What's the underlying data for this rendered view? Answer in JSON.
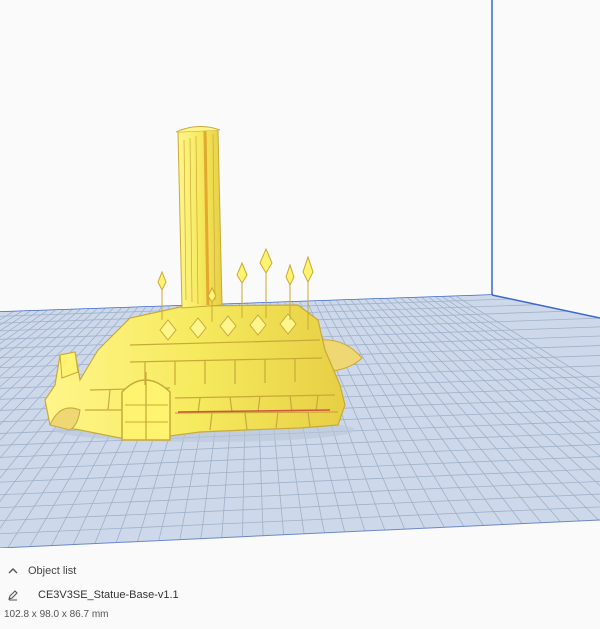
{
  "colors": {
    "background": "#fafafa",
    "grid_plate": "#cdd9ea",
    "grid_line": "#9fb1ca",
    "build_volume_line": "#3a67c9",
    "model": "#f6ea5e",
    "model_shadow": "#d8b93a"
  },
  "object_panel": {
    "header_label": "Object list",
    "header_icon": "chevron-up-icon",
    "object_icon": "pencil-icon",
    "object_name": "CE3V3SE_Statue-Base-v1.1",
    "dimensions": "102.8 x 98.0 x 86.7 mm"
  }
}
